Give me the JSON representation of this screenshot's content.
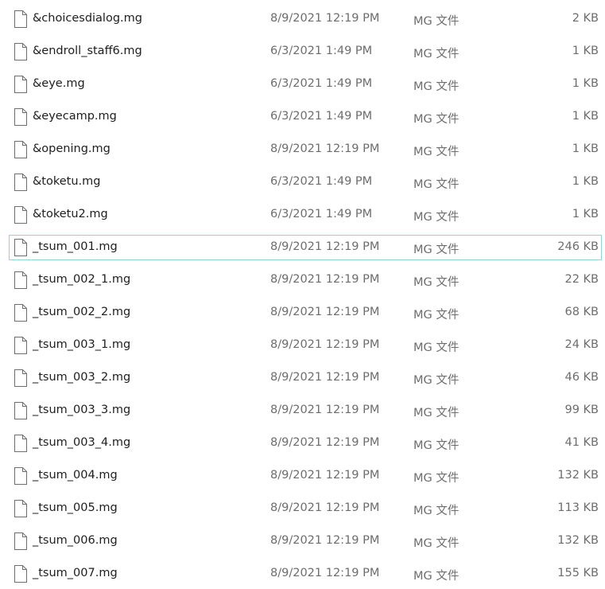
{
  "files": [
    {
      "name": "&choicesdialog.mg",
      "date": "8/9/2021 12:19 PM",
      "type": "MG 文件",
      "size": "2 KB"
    },
    {
      "name": "&endroll_staff6.mg",
      "date": "6/3/2021 1:49 PM",
      "type": "MG 文件",
      "size": "1 KB"
    },
    {
      "name": "&eye.mg",
      "date": "6/3/2021 1:49 PM",
      "type": "MG 文件",
      "size": "1 KB"
    },
    {
      "name": "&eyecamp.mg",
      "date": "6/3/2021 1:49 PM",
      "type": "MG 文件",
      "size": "1 KB"
    },
    {
      "name": "&opening.mg",
      "date": "8/9/2021 12:19 PM",
      "type": "MG 文件",
      "size": "1 KB"
    },
    {
      "name": "&toketu.mg",
      "date": "6/3/2021 1:49 PM",
      "type": "MG 文件",
      "size": "1 KB"
    },
    {
      "name": "&toketu2.mg",
      "date": "6/3/2021 1:49 PM",
      "type": "MG 文件",
      "size": "1 KB"
    },
    {
      "name": "_tsum_001.mg",
      "date": "8/9/2021 12:19 PM",
      "type": "MG 文件",
      "size": "246 KB",
      "hovered": true
    },
    {
      "name": "_tsum_002_1.mg",
      "date": "8/9/2021 12:19 PM",
      "type": "MG 文件",
      "size": "22 KB"
    },
    {
      "name": "_tsum_002_2.mg",
      "date": "8/9/2021 12:19 PM",
      "type": "MG 文件",
      "size": "68 KB"
    },
    {
      "name": "_tsum_003_1.mg",
      "date": "8/9/2021 12:19 PM",
      "type": "MG 文件",
      "size": "24 KB"
    },
    {
      "name": "_tsum_003_2.mg",
      "date": "8/9/2021 12:19 PM",
      "type": "MG 文件",
      "size": "46 KB"
    },
    {
      "name": "_tsum_003_3.mg",
      "date": "8/9/2021 12:19 PM",
      "type": "MG 文件",
      "size": "99 KB"
    },
    {
      "name": "_tsum_003_4.mg",
      "date": "8/9/2021 12:19 PM",
      "type": "MG 文件",
      "size": "41 KB"
    },
    {
      "name": "_tsum_004.mg",
      "date": "8/9/2021 12:19 PM",
      "type": "MG 文件",
      "size": "132 KB"
    },
    {
      "name": "_tsum_005.mg",
      "date": "8/9/2021 12:19 PM",
      "type": "MG 文件",
      "size": "113 KB"
    },
    {
      "name": "_tsum_006.mg",
      "date": "8/9/2021 12:19 PM",
      "type": "MG 文件",
      "size": "132 KB"
    },
    {
      "name": "_tsum_007.mg",
      "date": "8/9/2021 12:19 PM",
      "type": "MG 文件",
      "size": "155 KB"
    }
  ],
  "icons": {
    "file": "blank-file-icon"
  },
  "colors": {
    "hover_border": "#99d1db",
    "name_text": "#1e1e1e",
    "meta_text": "#6d6d6d"
  }
}
